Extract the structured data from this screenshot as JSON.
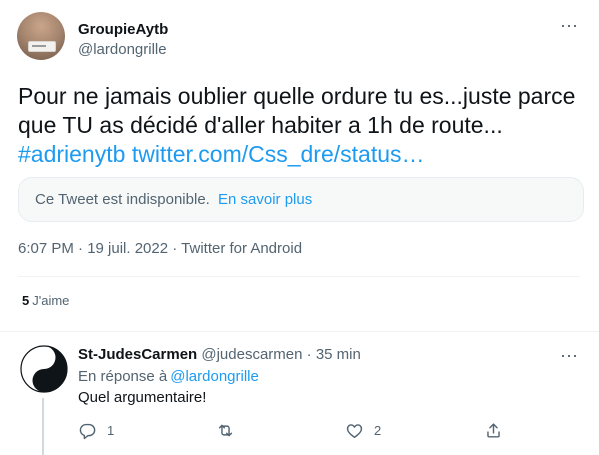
{
  "tweet": {
    "display_name": "GroupieAytb",
    "handle": "@lardongrille",
    "more_icon": "⋯",
    "text_line1": "Pour ne jamais oublier quelle ordure tu es...juste parce",
    "text_line2": "que TU as décidé d'aller habiter a 1h de route...",
    "hashtag": "#adrienytb",
    "link": "twitter.com/Css_dre/status…",
    "quote_unavailable": "Ce Tweet est indisponible.",
    "quote_learn_more": "En savoir plus",
    "meta": "6:07 PM · 19 juil. 2022 · Twitter for Android",
    "likes_count": "5",
    "likes_label": "J'aime"
  },
  "reply": {
    "display_name": "St-JudesCarmen",
    "handle": "@judescarmen",
    "dot": "·",
    "time": "35 min",
    "more_icon": "⋯",
    "in_reply_prefix": "En réponse à",
    "in_reply_handle": "@lardongrille",
    "text": "Quel argumentaire!",
    "reply_count": "1",
    "like_count": "2"
  },
  "colors": {
    "link": "#1d9bf0",
    "secondary_text": "#536471",
    "primary_text": "#0f1419"
  },
  "icons": {
    "avatar_main": "profile-photo",
    "avatar_reply": "yin-yang",
    "reply": "reply-icon",
    "retweet": "retweet-icon",
    "like": "heart-icon",
    "share": "share-icon"
  }
}
